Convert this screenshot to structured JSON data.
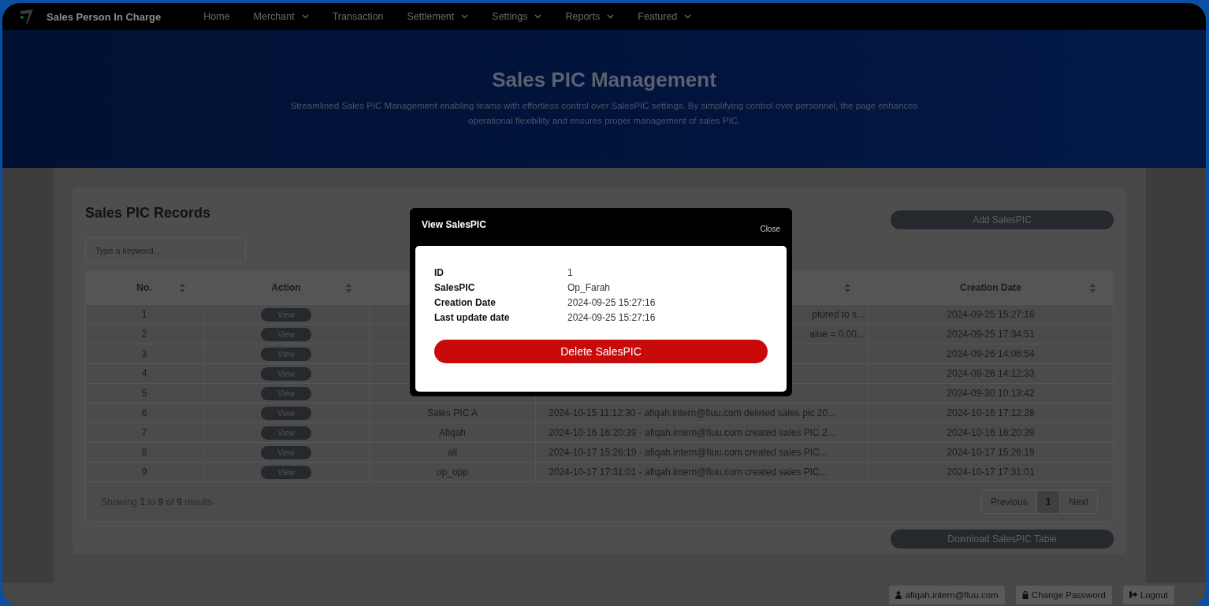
{
  "nav": {
    "brand": "Sales Person In Charge",
    "items": [
      {
        "label": "Home",
        "has_menu": false
      },
      {
        "label": "Merchant",
        "has_menu": true
      },
      {
        "label": "Transaction",
        "has_menu": false
      },
      {
        "label": "Settlement",
        "has_menu": true
      },
      {
        "label": "Settings",
        "has_menu": true
      },
      {
        "label": "Reports",
        "has_menu": true
      },
      {
        "label": "Featured",
        "has_menu": true
      }
    ]
  },
  "hero": {
    "title": "Sales PIC Management",
    "description": "Streamlined Sales PIC Management enabling teams with effortless control over SalesPIC settings. By simplifying control over personnel, the page enhances operational flexibility and ensures proper management of sales PIC."
  },
  "records": {
    "title": "Sales PIC Records",
    "add_button": "Add SalesPIC",
    "search": {
      "placeholder": "Type a keyword..."
    },
    "columns": [
      {
        "label": "No.",
        "sortable": true
      },
      {
        "label": "Action",
        "sortable": true
      },
      {},
      {
        "sortable": true
      },
      {
        "label": "Creation Date",
        "sortable": true
      }
    ],
    "rows": [
      {
        "no": "1",
        "action": "View",
        "log": "ptured to s...",
        "created": "2024-09-25 15:27:16"
      },
      {
        "no": "2",
        "action": "View",
        "log": "alue = 0.00...",
        "created": "2024-09-25 17:34:51"
      },
      {
        "no": "3",
        "action": "View",
        "created": "2024-09-26 14:06:54"
      },
      {
        "no": "4",
        "action": "View",
        "created": "2024-09-26 14:12:33"
      },
      {
        "no": "5",
        "action": "View",
        "created": "2024-09-30 10:13:42"
      },
      {
        "no": "6",
        "action": "View",
        "salespic": "Sales PIC A",
        "log": "2024-10-15 11:12:30 - afiqah.intern@fiuu.com deleted sales pic 20...",
        "created": "2024-10-16 17:12:28"
      },
      {
        "no": "7",
        "action": "View",
        "salespic": "Afiqah",
        "log": "2024-10-16 16:20:39 - afiqah.intern@fiuu.com created sales PIC 2...",
        "created": "2024-10-16 16:20:39"
      },
      {
        "no": "8",
        "action": "View",
        "salespic": "ali",
        "log": "2024-10-17 15:26:19 - afiqah.intern@fiuu.com created sales PIC...",
        "created": "2024-10-17 15:26:19"
      },
      {
        "no": "9",
        "action": "View",
        "salespic": "op_opp",
        "log": "2024-10-17 17:31:01 - afiqah.intern@fiuu.com created sales PIC...",
        "created": "2024-10-17 17:31:01"
      }
    ],
    "summary": "Showing **1** to **9** of **9** results",
    "pagination": [
      {
        "label": "Previous",
        "selected": false
      },
      {
        "label": "1",
        "selected": true
      },
      {
        "label": "Next",
        "selected": false
      }
    ],
    "download_button": "Download SalesPIC Table"
  },
  "modal": {
    "title": "View SalesPIC",
    "close": "Close",
    "fields": [
      {
        "label": "ID",
        "value": "1"
      },
      {
        "label": "SalesPIC",
        "value": "Op_Farah"
      },
      {
        "label": "Creation Date",
        "value": "2024-09-25 15:27:16"
      },
      {
        "label": "Last update date",
        "value": "2024-09-25 15:27:16"
      }
    ],
    "delete_button": "Delete SalesPIC"
  },
  "status_bar": {
    "user": "afiqah.intern@fiuu.com",
    "change_password": "Change Password",
    "logout": "Logout"
  }
}
